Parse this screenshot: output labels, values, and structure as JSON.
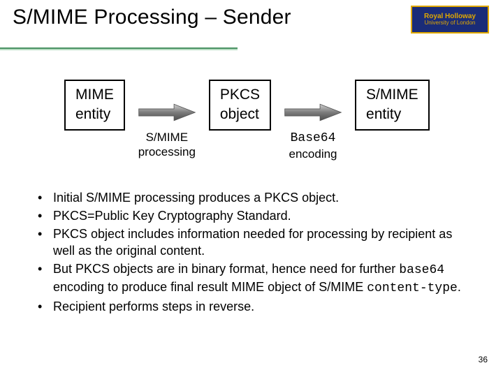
{
  "title": "S/MIME Processing – Sender",
  "logo": {
    "line1": "Royal Holloway",
    "line2": "University of London"
  },
  "diagram": {
    "box1": {
      "line1": "MIME",
      "line2": "entity"
    },
    "arrow1_caption": {
      "line1": "S/MIME",
      "line2": "processing"
    },
    "box2": {
      "line1": "PKCS",
      "line2": "object"
    },
    "arrow2_caption": {
      "line1_mono": "Base64",
      "line2": "encoding"
    },
    "box3": {
      "line1": "S/MIME",
      "line2": "entity"
    }
  },
  "bullets": {
    "b1": "Initial S/MIME processing produces a PKCS object.",
    "b2": "PKCS=Public Key Cryptography Standard.",
    "b3": "PKCS object includes information needed for processing by recipient as well as the original content.",
    "b4_pre": "But PKCS objects are in binary format, hence need for further ",
    "b4_mono1": "base64",
    "b4_mid": " encoding to produce final result MIME object of S/MIME ",
    "b4_mono2": "content-type",
    "b4_post": ".",
    "b5": "Recipient performs steps in reverse."
  },
  "page_number": "36"
}
